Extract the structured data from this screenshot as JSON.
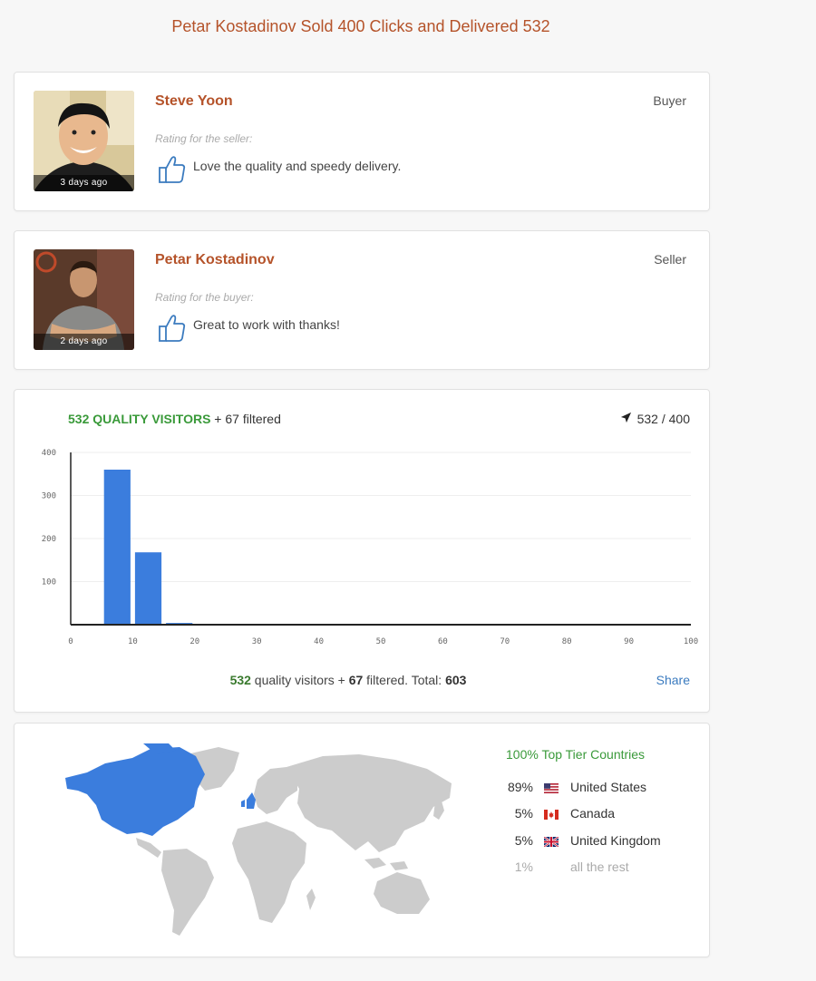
{
  "page": {
    "title": "Petar Kostadinov Sold 400 Clicks and Delivered 532"
  },
  "reviews": [
    {
      "name": "Steve Yoon",
      "role": "Buyer",
      "time": "3 days ago",
      "rating_label": "Rating for the seller:",
      "text": "Love the quality and speedy delivery."
    },
    {
      "name": "Petar Kostadinov",
      "role": "Seller",
      "time": "2 days ago",
      "rating_label": "Rating for the buyer:",
      "text": "Great to work with thanks!"
    }
  ],
  "stats": {
    "quality_label": "532 QUALITY VISITORS",
    "filtered_label": " + 67 filtered",
    "delivered_label": "532 / 400",
    "summary": {
      "quality": "532",
      "quality_text": " quality visitors + ",
      "filtered": "67",
      "filtered_text": " filtered. Total: ",
      "total": "603"
    },
    "share_label": "Share"
  },
  "chart_data": {
    "type": "bar",
    "x": [
      5,
      10,
      15,
      20,
      25,
      30,
      35,
      40,
      45,
      50,
      55,
      60,
      65,
      70,
      75,
      80,
      85,
      90,
      95,
      100
    ],
    "values": [
      0,
      360,
      168,
      4,
      0,
      0,
      0,
      0,
      0,
      0,
      0,
      0,
      0,
      0,
      0,
      0,
      0,
      0,
      0,
      0
    ],
    "xlim": [
      0,
      100
    ],
    "ylim": [
      0,
      400
    ],
    "xticks": [
      0,
      10,
      20,
      30,
      40,
      50,
      60,
      70,
      80,
      90,
      100
    ],
    "yticks": [
      100,
      200,
      300,
      400
    ],
    "color": "#3b7ddd",
    "grid": true
  },
  "countries": {
    "title": "100% Top Tier Countries",
    "items": [
      {
        "pct": "89%",
        "name": "United States",
        "flag": "us"
      },
      {
        "pct": "5%",
        "name": "Canada",
        "flag": "ca"
      },
      {
        "pct": "5%",
        "name": "United Kingdom",
        "flag": "gb"
      },
      {
        "pct": "1%",
        "name": "all the rest",
        "flag": ""
      }
    ],
    "highlight_color": "#3b7ddd",
    "base_color": "#cccccc"
  }
}
